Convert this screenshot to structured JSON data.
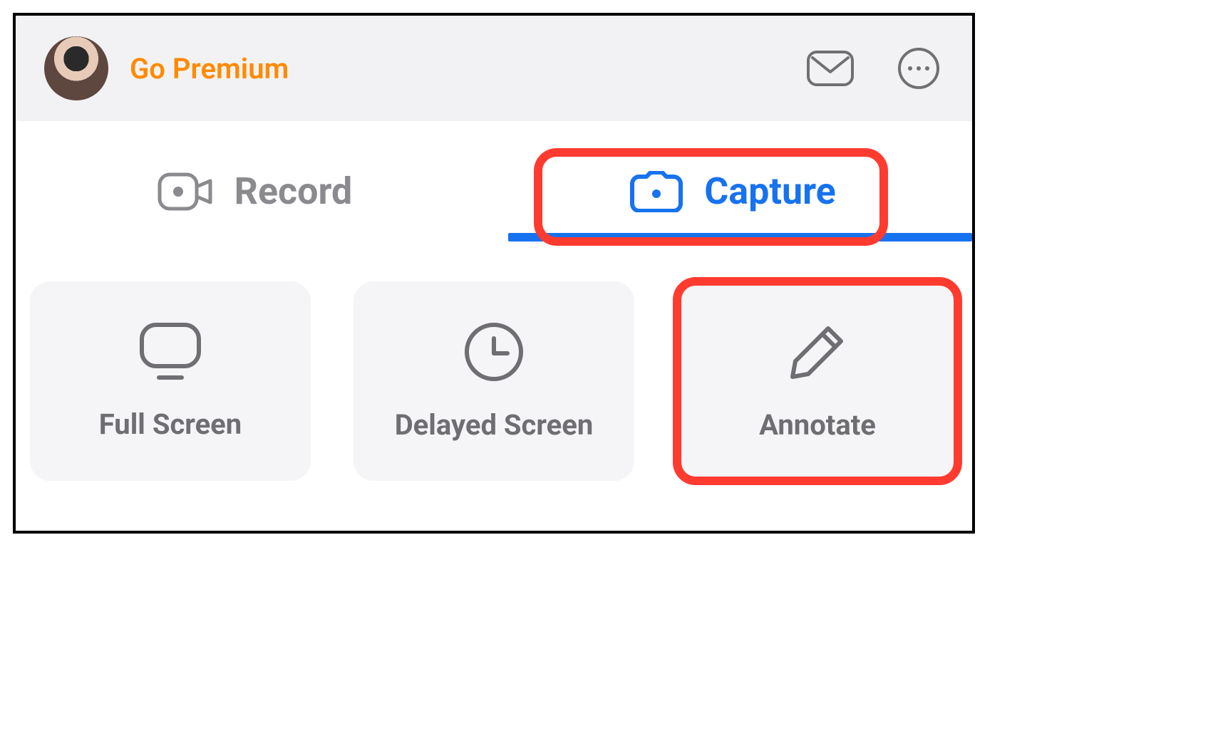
{
  "header": {
    "go_premium": "Go Premium",
    "icons": {
      "mail": "mail-icon",
      "more": "more-icon",
      "avatar": "user-avatar"
    }
  },
  "tabs": {
    "record_label": "Record",
    "capture_label": "Capture",
    "active": "capture"
  },
  "tiles": {
    "full_screen": "Full Screen",
    "delayed_screen": "Delayed Screen",
    "annotate": "Annotate"
  },
  "highlights": {
    "capture_tab": true,
    "annotate_tile": true
  },
  "colors": {
    "accent": "#1772ef",
    "premium": "#ff8a00",
    "highlight": "#ff3b30"
  }
}
